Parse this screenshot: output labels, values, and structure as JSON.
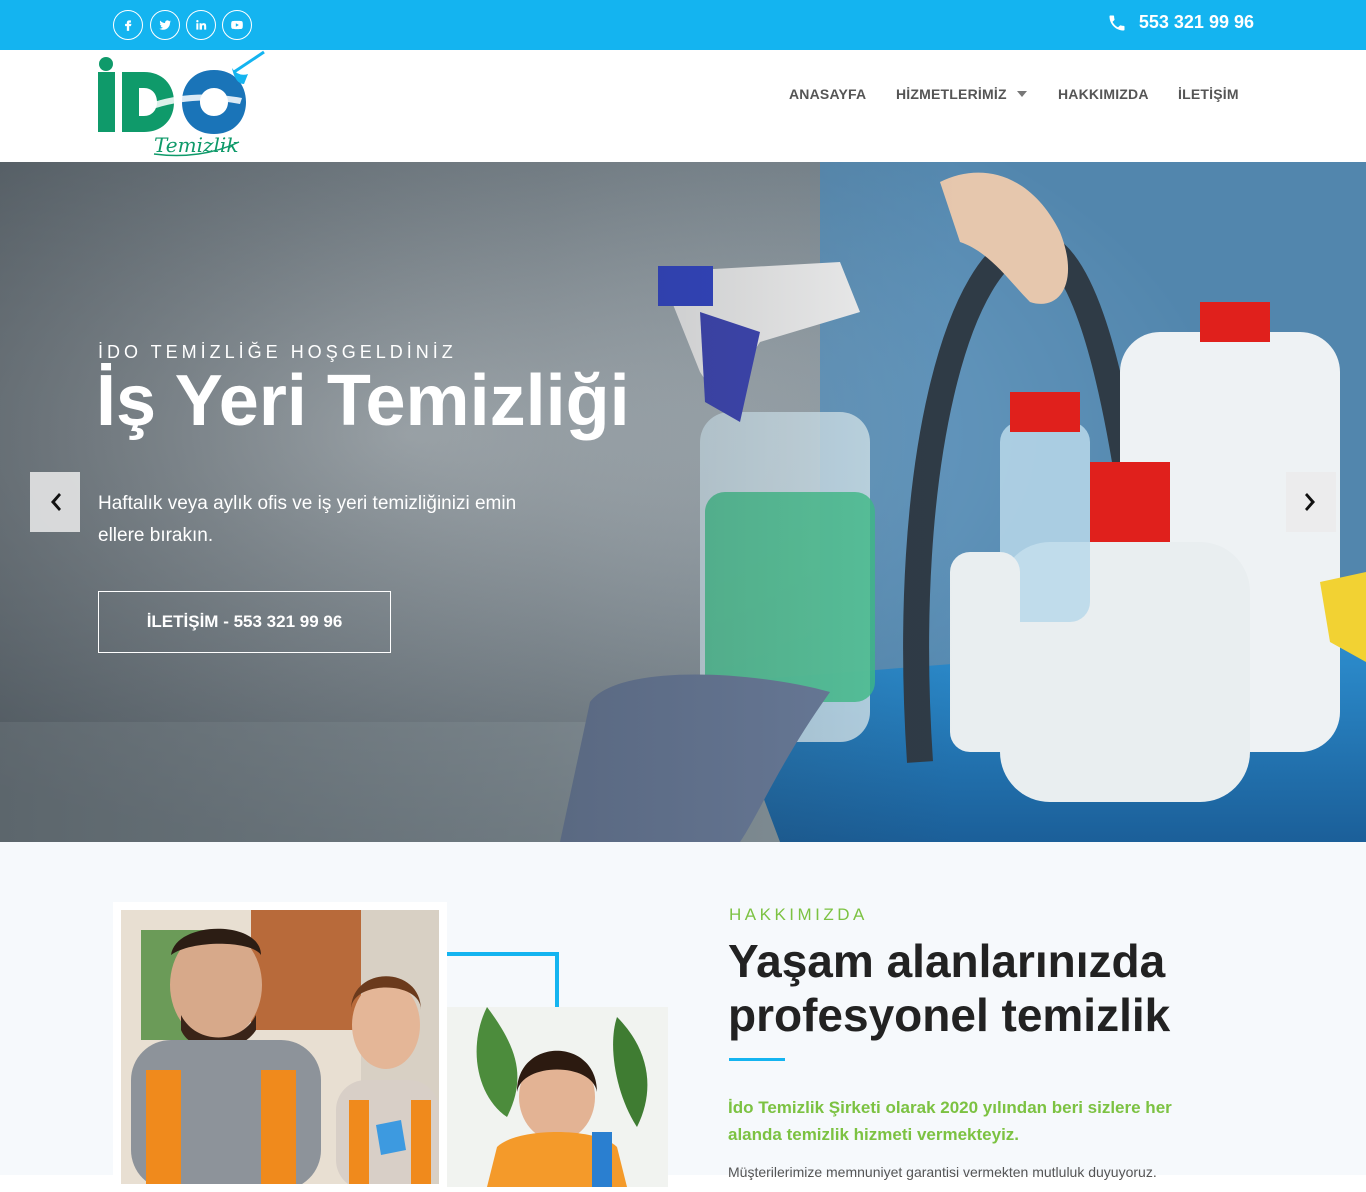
{
  "topbar": {
    "phone": "553 321 99 96",
    "socials": [
      "facebook-icon",
      "twitter-icon",
      "linkedin-icon",
      "youtube-icon"
    ],
    "background_color": "#14b4f0"
  },
  "header": {
    "logo_text": "İDO",
    "logo_subtext": "Temizlik",
    "nav": [
      {
        "label": "ANASAYFA"
      },
      {
        "label": "HİZMETLERİMİZ",
        "has_dropdown": true
      },
      {
        "label": "HAKKIMIZDA"
      },
      {
        "label": "İLETİŞİM"
      }
    ]
  },
  "hero": {
    "kicker": "İDO TEMİZLİĞE HOŞGELDİNİZ",
    "title": "İş Yeri Temizliği",
    "text": "Haftalık veya aylık ofis ve iş yeri temizliğinizi emin ellere bırakın.",
    "button_label": "İLETİŞİM - 553 321 99 96"
  },
  "about": {
    "kicker": "HAKKIMIZDA",
    "title": "Yaşam alanlarınızda profesyonel temizlik",
    "lead": "İdo Temizlik Şirketi olarak 2020 yılından beri sizlere her alanda temizlik hizmeti vermekteyiz.",
    "body": "Müşterilerimize memnuniyet garantisi vermekten mutluluk duyuyoruz.",
    "accent_color": "#7cc242"
  }
}
